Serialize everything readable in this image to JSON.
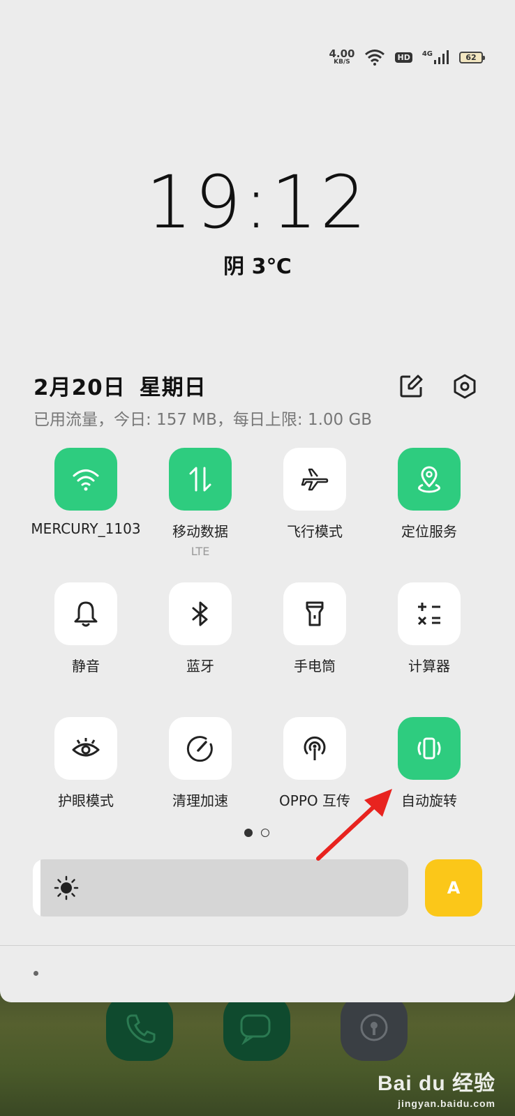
{
  "status": {
    "speed_value": "4.00",
    "speed_unit": "KB/S",
    "hd": "HD",
    "network": "4G",
    "battery": "62"
  },
  "lockscreen": {
    "time": "19:12",
    "weather": "阴 3℃"
  },
  "header": {
    "date": "2月20日",
    "weekday": "星期日",
    "data_usage": "已用流量，今日: 157 MB，每日上限: 1.00 GB"
  },
  "tiles": [
    {
      "label": "MERCURY_1103",
      "icon": "wifi-icon",
      "on": true
    },
    {
      "label": "移动数据",
      "sublabel": "LTE",
      "icon": "mobile-data-icon",
      "on": true
    },
    {
      "label": "飞行模式",
      "icon": "airplane-icon",
      "on": false
    },
    {
      "label": "定位服务",
      "icon": "location-icon",
      "on": true
    },
    {
      "label": "静音",
      "icon": "bell-icon",
      "on": false
    },
    {
      "label": "蓝牙",
      "icon": "bluetooth-icon",
      "on": false
    },
    {
      "label": "手电筒",
      "icon": "flashlight-icon",
      "on": false
    },
    {
      "label": "计算器",
      "icon": "calculator-icon",
      "on": false
    },
    {
      "label": "护眼模式",
      "icon": "eye-icon",
      "on": false
    },
    {
      "label": "清理加速",
      "icon": "speed-gauge-icon",
      "on": false
    },
    {
      "label": "OPPO 互传",
      "icon": "share-antenna-icon",
      "on": false
    },
    {
      "label": "自动旋转",
      "icon": "auto-rotate-icon",
      "on": true
    }
  ],
  "pagination": {
    "current": 1,
    "total": 2
  },
  "brightness": {
    "level": 0.02,
    "auto_label": "A"
  },
  "colors": {
    "tile_on": "#2ecc7f",
    "tile_off": "#ffffff",
    "auto_button": "#fbc719",
    "annotation_arrow": "#e8231f"
  },
  "watermark": {
    "main": "Bai du 经验",
    "sub": "jingyan.baidu.com"
  }
}
